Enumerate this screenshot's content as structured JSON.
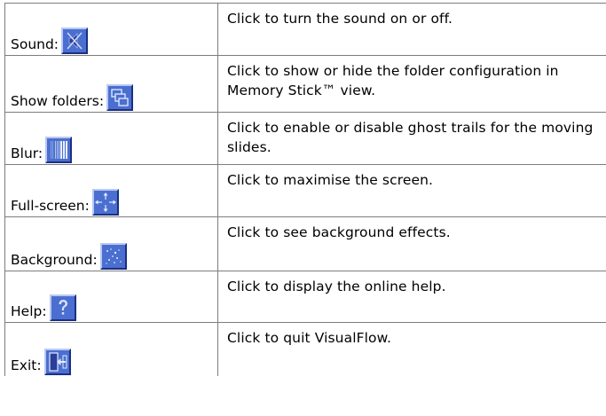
{
  "rows": [
    {
      "label": "Sound:",
      "icon": "sound-mute-icon",
      "description": "Click to turn the sound on or off."
    },
    {
      "label": "Show folders:",
      "icon": "folders-icon",
      "description": "Click to show or hide the folder configuration in Memory Stick™ view."
    },
    {
      "label": "Blur:",
      "icon": "blur-icon",
      "description": "Click to enable or disable ghost trails for the moving slides."
    },
    {
      "label": "Full-screen:",
      "icon": "fullscreen-arrows-icon",
      "description": "Click to maximise the screen."
    },
    {
      "label": "Background:",
      "icon": "background-sparkle-icon",
      "description": "Click to see background effects."
    },
    {
      "label": "Help:",
      "icon": "help-question-icon",
      "description": "Click to display the online help."
    },
    {
      "label": "Exit:",
      "icon": "exit-door-icon",
      "description": "Click to quit VisualFlow."
    }
  ],
  "colors": {
    "icon_fill": "#4a6fd0",
    "icon_highlight": "#b9c8f2",
    "icon_shadow": "#1c2f82",
    "table_border": "#7d7d7d"
  }
}
